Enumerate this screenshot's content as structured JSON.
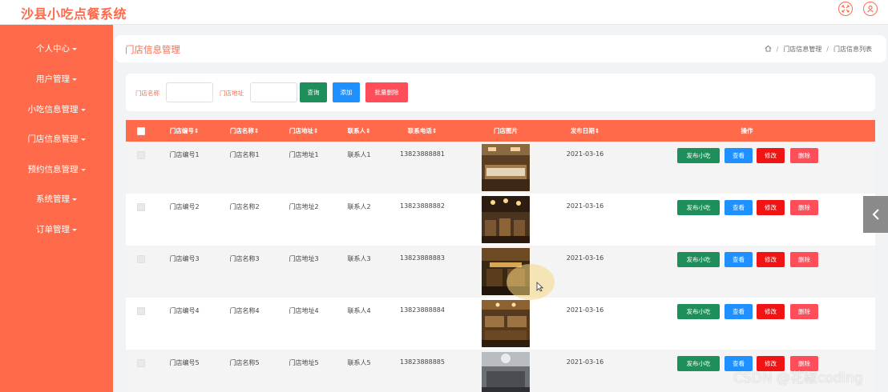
{
  "app": {
    "title": "沙县小吃点餐系统"
  },
  "sidebar": {
    "items": [
      {
        "label": "个人中心"
      },
      {
        "label": "用户管理"
      },
      {
        "label": "小吃信息管理"
      },
      {
        "label": "门店信息管理"
      },
      {
        "label": "预约信息管理"
      },
      {
        "label": "系统管理"
      },
      {
        "label": "订单管理"
      }
    ]
  },
  "header": {
    "page_title": "门店信息管理",
    "breadcrumb": [
      "门店信息管理",
      "门店信息列表"
    ]
  },
  "search": {
    "fields": [
      {
        "label": "门店名称",
        "value": ""
      },
      {
        "label": "门店地址",
        "value": ""
      }
    ],
    "buttons": {
      "query": "查询",
      "add": "添加",
      "batch_delete": "批量删除"
    }
  },
  "table": {
    "columns": [
      {
        "label": "门店编号"
      },
      {
        "label": "门店名称"
      },
      {
        "label": "门店地址"
      },
      {
        "label": "联系人"
      },
      {
        "label": "联系电话"
      },
      {
        "label": "门店图片"
      },
      {
        "label": "发布日期"
      },
      {
        "label": "操作"
      }
    ],
    "actions": {
      "publish": "发布小吃",
      "view": "查看",
      "edit": "修改",
      "delete": "删除"
    },
    "rows": [
      {
        "id": "门店编号1",
        "name": "门店名称1",
        "address": "门店地址1",
        "contact": "联系人1",
        "phone": "13823888881",
        "date": "2021-03-16"
      },
      {
        "id": "门店编号2",
        "name": "门店名称2",
        "address": "门店地址2",
        "contact": "联系人2",
        "phone": "13823888882",
        "date": "2021-03-16"
      },
      {
        "id": "门店编号3",
        "name": "门店名称3",
        "address": "门店地址3",
        "contact": "联系人3",
        "phone": "13823888883",
        "date": "2021-03-16"
      },
      {
        "id": "门店编号4",
        "name": "门店名称4",
        "address": "门店地址4",
        "contact": "联系人4",
        "phone": "13823888884",
        "date": "2021-03-16"
      },
      {
        "id": "门店编号5",
        "name": "门店名称5",
        "address": "门店地址5",
        "contact": "联系人5",
        "phone": "13823888885",
        "date": "2021-03-16"
      }
    ]
  },
  "watermark": "CSDN @花椒coding",
  "colors": {
    "accent": "#ff6a4a",
    "publish": "#1e8f5a",
    "view": "#1e90ff",
    "edit": "#f01414",
    "delete": "#ff4d5a",
    "query": "#1e8f5a",
    "add": "#1e90ff",
    "batch_delete": "#ff4d5a"
  },
  "icons": {
    "fullscreen": "fullscreen-icon",
    "user": "user-icon",
    "home": "home-icon",
    "collapse": "chevron-left-icon"
  }
}
